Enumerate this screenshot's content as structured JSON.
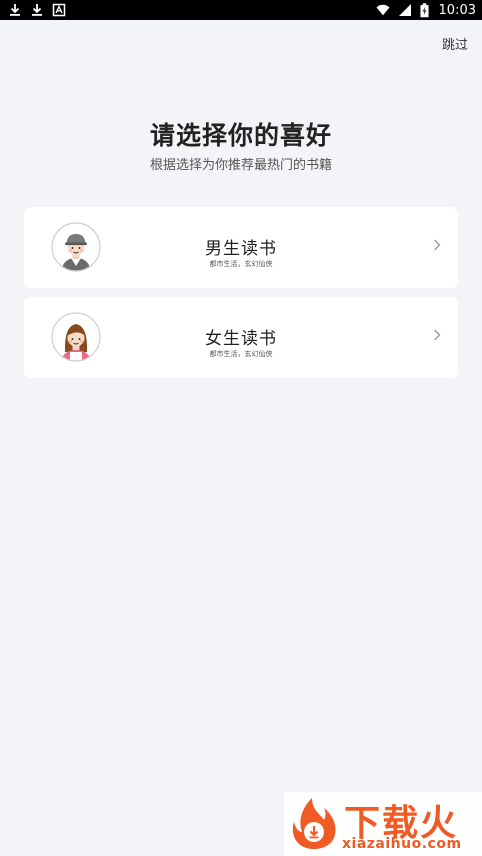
{
  "status_bar": {
    "time": "10:03",
    "left_icons": [
      "download-icon",
      "download-icon",
      "notification-icon"
    ],
    "right_icons": [
      "wifi-icon",
      "signal-icon",
      "battery-icon"
    ]
  },
  "header": {
    "skip_label": "跳过"
  },
  "main": {
    "title": "请选择你的喜好",
    "subtitle": "根据选择为你推荐最热门的书籍"
  },
  "options": [
    {
      "title": "男生读书",
      "subtitle": "都市生活，玄幻仙侠",
      "avatar": "male-avatar-icon"
    },
    {
      "title": "女生读书",
      "subtitle": "都市生活，玄幻仙侠",
      "avatar": "female-avatar-icon"
    }
  ],
  "watermark": {
    "brand": "下载火",
    "domain": "xiazaihuo.com",
    "color": "#f05a24"
  }
}
